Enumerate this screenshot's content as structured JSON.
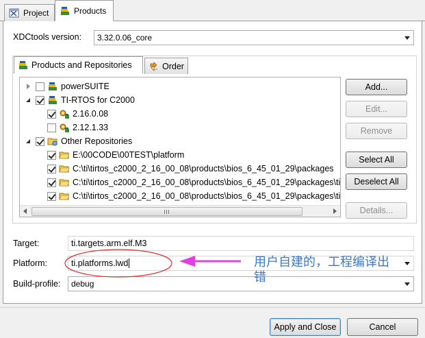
{
  "tabs": [
    {
      "label": "Project",
      "icon": "project-icon",
      "active": false
    },
    {
      "label": "Products",
      "icon": "products-icon",
      "active": true
    }
  ],
  "xdctools": {
    "label": "XDCtools version:",
    "value": "3.32.0.06_core"
  },
  "inner_tabs": [
    {
      "label": "Products and Repositories",
      "icon": "products-icon",
      "active": true
    },
    {
      "label": "Order",
      "icon": "order-icon",
      "active": false
    }
  ],
  "tree": [
    {
      "label": "powerSUITE",
      "level": 0,
      "expanded": false,
      "checked": false,
      "icon": "products-icon"
    },
    {
      "label": "TI-RTOS for C2000",
      "level": 0,
      "expanded": true,
      "checked": true,
      "icon": "products-icon"
    },
    {
      "label": "2.16.0.08",
      "level": 1,
      "checked": true,
      "icon": "version-icon"
    },
    {
      "label": "2.12.1.33",
      "level": 1,
      "checked": false,
      "icon": "version-icon"
    },
    {
      "label": "Other Repositories",
      "level": 0,
      "expanded": true,
      "checked": true,
      "icon": "repository-icon"
    },
    {
      "label": "E:\\00CODE\\00TEST\\platform",
      "level": 1,
      "checked": true,
      "icon": "folder-icon"
    },
    {
      "label": "C:\\ti\\tirtos_c2000_2_16_00_08\\products\\bios_6_45_01_29\\packages",
      "level": 1,
      "checked": true,
      "icon": "folder-icon"
    },
    {
      "label": "C:\\ti\\tirtos_c2000_2_16_00_08\\products\\bios_6_45_01_29\\packages\\ti",
      "level": 1,
      "checked": true,
      "icon": "folder-icon"
    },
    {
      "label": "C:\\ti\\tirtos_c2000_2_16_00_08\\products\\bios_6_45_01_29\\packages\\ti",
      "level": 1,
      "checked": true,
      "icon": "folder-icon"
    }
  ],
  "side_buttons": {
    "add": {
      "label": "Add...",
      "enabled": true
    },
    "edit": {
      "label": "Edit...",
      "enabled": false
    },
    "remove": {
      "label": "Remove",
      "enabled": false
    },
    "select_all": {
      "label": "Select All",
      "enabled": true
    },
    "deselect_all": {
      "label": "Deselect All",
      "enabled": true
    },
    "details": {
      "label": "Details...",
      "enabled": false
    }
  },
  "target": {
    "label": "Target:",
    "value": "ti.targets.arm.elf.M3"
  },
  "platform": {
    "label": "Platform:",
    "value": "ti.platforms.lwd"
  },
  "build_profile": {
    "label": "Build-profile:",
    "value": "debug"
  },
  "annotation": {
    "line1": "用户自建的，工程编译出",
    "line2": "错",
    "color": "#e040e0",
    "ellipse_color": "#e03030"
  },
  "footer": {
    "apply_close": "Apply and Close",
    "cancel": "Cancel"
  }
}
